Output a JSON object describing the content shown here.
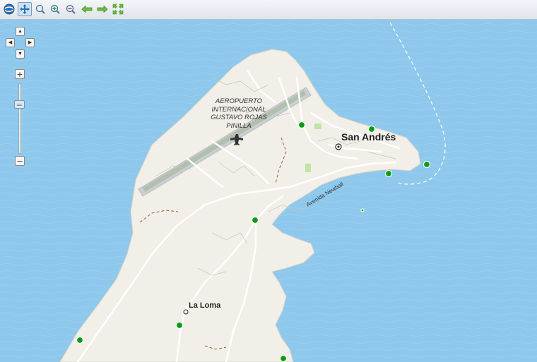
{
  "toolbar": {
    "tools": [
      {
        "name": "globe-icon",
        "active": false
      },
      {
        "name": "pan-icon",
        "active": true
      },
      {
        "name": "zoom-box-icon",
        "active": false
      },
      {
        "name": "zoom-in-icon",
        "active": false
      },
      {
        "name": "zoom-out-icon",
        "active": false
      },
      {
        "name": "history-back-icon",
        "active": false
      },
      {
        "name": "history-forward-icon",
        "active": false
      },
      {
        "name": "zoom-extent-icon",
        "active": false
      }
    ]
  },
  "navigation": {
    "pan_up": "▲",
    "pan_left": "◀",
    "pan_right": "▶",
    "pan_down": "▼",
    "zoom_in": "+",
    "zoom_out": "−",
    "zoom_level_fraction": 0.27
  },
  "map": {
    "airport_name": "AEROPUERTO INTERNACIONAL GUSTAVO ROJAS PINILLA",
    "airport_lines": [
      "AEROPUERTO",
      "INTERNACIONAL",
      "GUSTAVO ROJAS",
      "PINILLA"
    ],
    "city": "San Andrés",
    "town": "La Loma",
    "street": "Avenida Newball",
    "marker_count": 9,
    "colors": {
      "sea": "#8ec8ec",
      "land": "#f1efe8",
      "marker": "#0a9b12",
      "runway": "#c9cfd2",
      "runway_stripe": "#a8b89c"
    }
  }
}
